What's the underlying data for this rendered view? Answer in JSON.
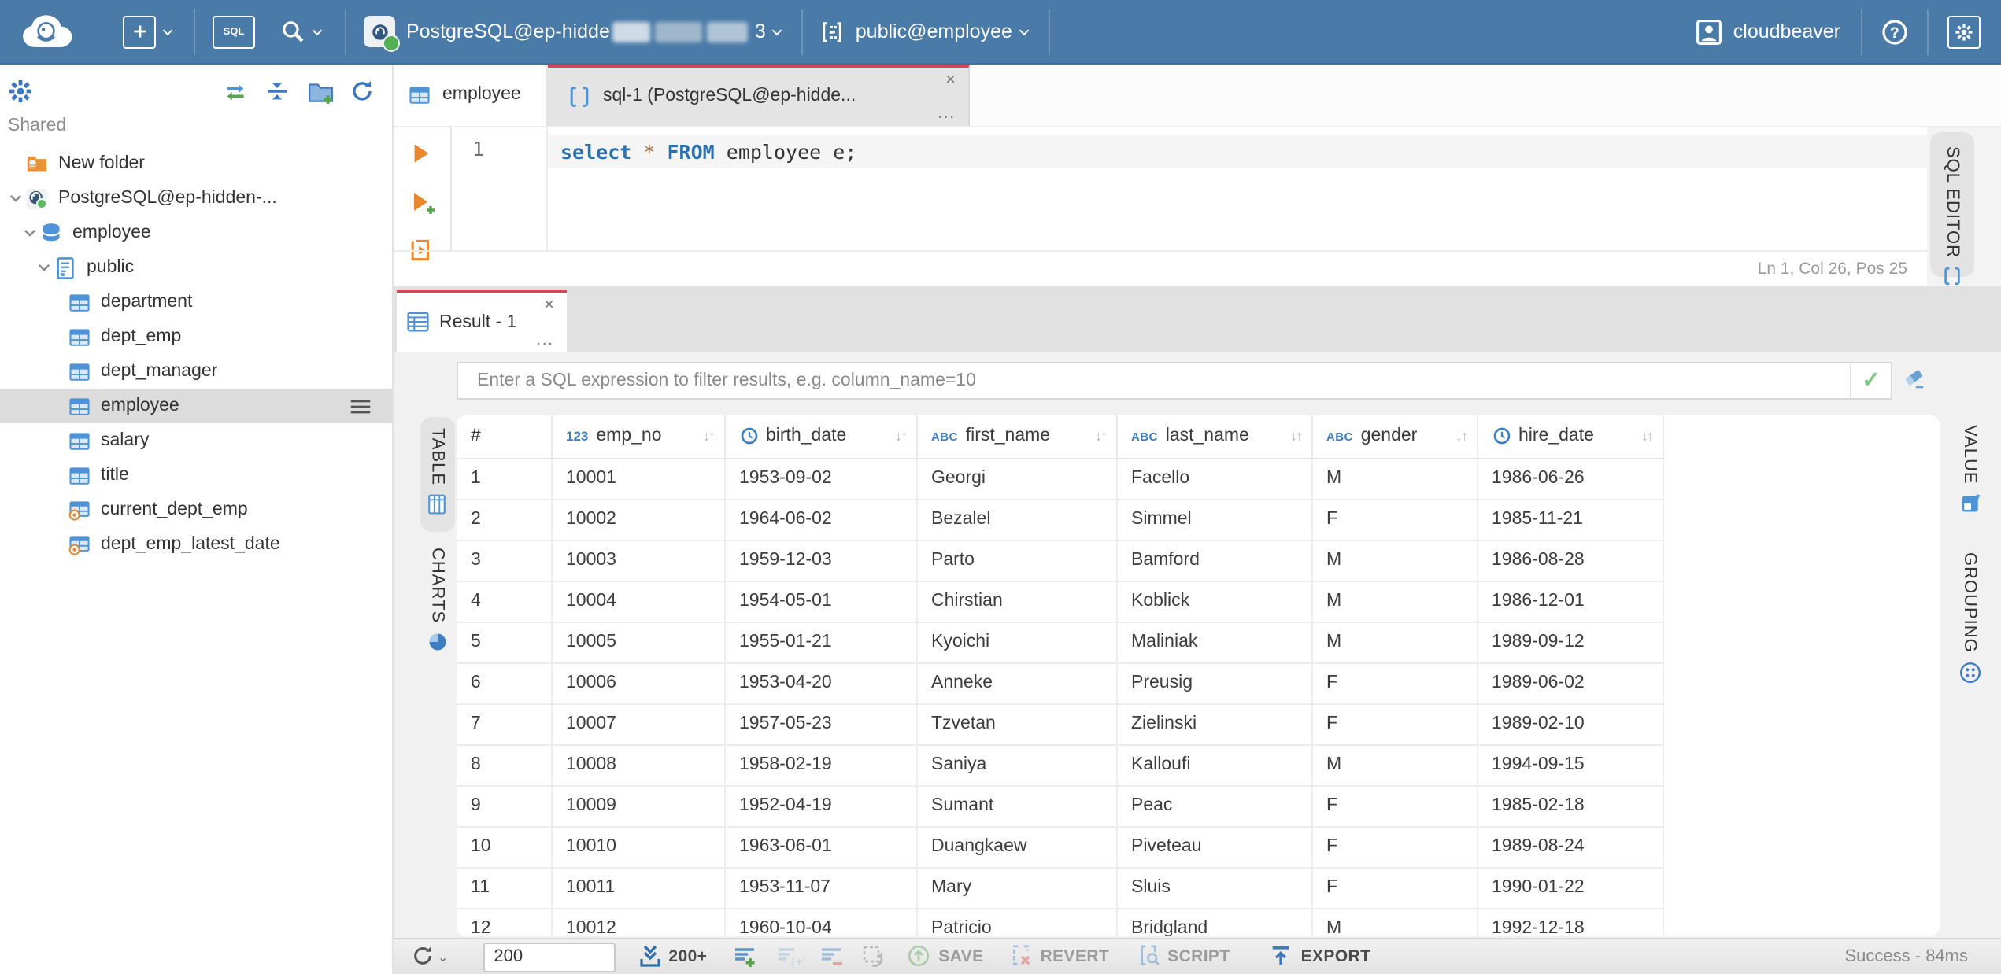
{
  "header": {
    "connection_label": "PostgreSQL@ep-hidde",
    "connection_suffix": "3",
    "schema_label": "public@employee",
    "sql_badge": "SQL",
    "username": "cloudbeaver",
    "help_glyph": "?"
  },
  "sidebar": {
    "section_label": "Shared",
    "tree": [
      {
        "label": "New folder",
        "icon": "folder-database-icon",
        "level": 0
      },
      {
        "label": "PostgreSQL@ep-hidden-...",
        "icon": "postgres-icon",
        "level": 0,
        "expanded": true
      },
      {
        "label": "employee",
        "icon": "database-icon",
        "level": 1,
        "expanded": true
      },
      {
        "label": "public",
        "icon": "schema-icon",
        "level": 2,
        "expanded": true
      },
      {
        "label": "department",
        "icon": "table-icon",
        "level": 3
      },
      {
        "label": "dept_emp",
        "icon": "table-icon",
        "level": 3
      },
      {
        "label": "dept_manager",
        "icon": "table-icon",
        "level": 3
      },
      {
        "label": "employee",
        "icon": "table-icon",
        "level": 3,
        "selected": true
      },
      {
        "label": "salary",
        "icon": "table-icon",
        "level": 3
      },
      {
        "label": "title",
        "icon": "table-icon",
        "level": 3
      },
      {
        "label": "current_dept_emp",
        "icon": "view-icon",
        "level": 3
      },
      {
        "label": "dept_emp_latest_date",
        "icon": "view-icon",
        "level": 3
      }
    ]
  },
  "tabs": {
    "employee_label": "employee",
    "sql_label": "sql-1 (PostgreSQL@ep-hidde...",
    "close_glyph": "×",
    "more_glyph": "..."
  },
  "editor": {
    "line_number": "1",
    "code": {
      "kw1": "select",
      "star": "*",
      "kw2": "FROM",
      "rest": "employee e;"
    },
    "status": "Ln 1, Col 26, Pos 25",
    "side_tab": "SQL EDITOR"
  },
  "result": {
    "tab_label": "Result - 1",
    "filter_placeholder": "Enter a SQL expression to filter results, e.g. column_name=10",
    "left_tabs": {
      "table": "TABLE",
      "charts": "CHARTS"
    },
    "right_tabs": {
      "value": "VALUE",
      "grouping": "GROUPING"
    },
    "grid": {
      "columns": [
        {
          "name": "#",
          "type": "none"
        },
        {
          "name": "emp_no",
          "type": "number"
        },
        {
          "name": "birth_date",
          "type": "date"
        },
        {
          "name": "first_name",
          "type": "string"
        },
        {
          "name": "last_name",
          "type": "string"
        },
        {
          "name": "gender",
          "type": "string"
        },
        {
          "name": "hire_date",
          "type": "date"
        }
      ],
      "rows": [
        [
          "1",
          "10001",
          "1953-09-02",
          "Georgi",
          "Facello",
          "M",
          "1986-06-26"
        ],
        [
          "2",
          "10002",
          "1964-06-02",
          "Bezalel",
          "Simmel",
          "F",
          "1985-11-21"
        ],
        [
          "3",
          "10003",
          "1959-12-03",
          "Parto",
          "Bamford",
          "M",
          "1986-08-28"
        ],
        [
          "4",
          "10004",
          "1954-05-01",
          "Chirstian",
          "Koblick",
          "M",
          "1986-12-01"
        ],
        [
          "5",
          "10005",
          "1955-01-21",
          "Kyoichi",
          "Maliniak",
          "M",
          "1989-09-12"
        ],
        [
          "6",
          "10006",
          "1953-04-20",
          "Anneke",
          "Preusig",
          "F",
          "1989-06-02"
        ],
        [
          "7",
          "10007",
          "1957-05-23",
          "Tzvetan",
          "Zielinski",
          "F",
          "1989-02-10"
        ],
        [
          "8",
          "10008",
          "1958-02-19",
          "Saniya",
          "Kalloufi",
          "M",
          "1994-09-15"
        ],
        [
          "9",
          "10009",
          "1952-04-19",
          "Sumant",
          "Peac",
          "F",
          "1985-02-18"
        ],
        [
          "10",
          "10010",
          "1963-06-01",
          "Duangkaew",
          "Piveteau",
          "F",
          "1989-08-24"
        ],
        [
          "11",
          "10011",
          "1953-11-07",
          "Mary",
          "Sluis",
          "F",
          "1990-01-22"
        ],
        [
          "12",
          "10012",
          "1960-10-04",
          "Patricio",
          "Bridgland",
          "M",
          "1992-12-18"
        ]
      ]
    },
    "toolbar": {
      "fetch_size": "200",
      "fetch_more_label": "200+",
      "save_label": "SAVE",
      "revert_label": "REVERT",
      "script_label": "SCRIPT",
      "export_label": "EXPORT",
      "status": "Success - 84ms"
    }
  },
  "colors": {
    "header_blue": "#4a7aa8",
    "accent_red": "#cf4956",
    "icon_blue": "#4e93d6",
    "exec_orange": "#e8872e",
    "status_green": "#54b054"
  }
}
